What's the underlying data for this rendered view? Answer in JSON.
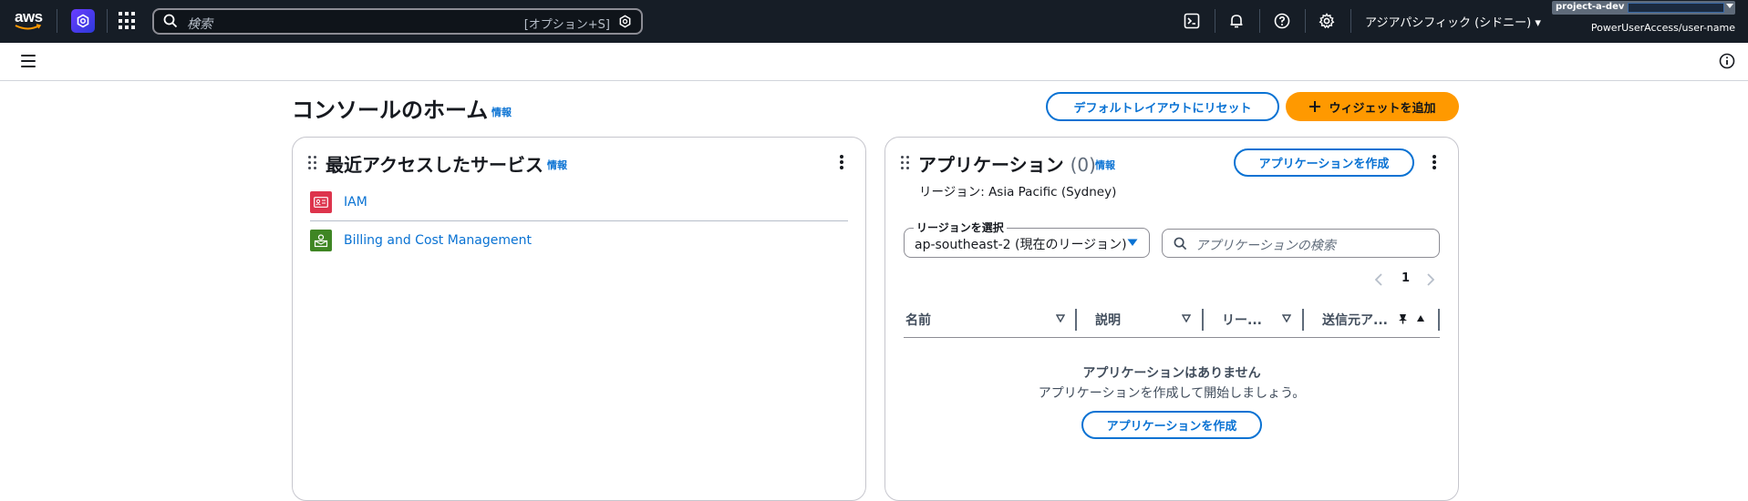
{
  "topnav": {
    "logo_text": "aws",
    "search_placeholder": "検索",
    "search_shortcut": "[オプション+S]",
    "region_label": "アジアパシフィック (シドニー) ▾",
    "account_label": "project-a-dev",
    "role_label": "PowerUserAccess/user-name",
    "icons": [
      "cloudshell-icon",
      "bell-icon",
      "help-icon",
      "gear-icon"
    ]
  },
  "page": {
    "title": "コンソールのホーム",
    "info": "情報",
    "reset_button": "デフォルトレイアウトにリセット",
    "add_widget_button": "ウィジェットを追加"
  },
  "recent_widget": {
    "title": "最近アクセスしたサービス",
    "info": "情報",
    "services": [
      {
        "name": "IAM",
        "color": "#dd344c"
      },
      {
        "name": "Billing and Cost Management",
        "color": "#3f8624"
      }
    ]
  },
  "apps_widget": {
    "title": "アプリケーション",
    "count": "(0)",
    "info": "情報",
    "create_button": "アプリケーションを作成",
    "region_text": "リージョン: Asia Pacific (Sydney)",
    "region_select_label": "リージョンを選択",
    "region_select_value": "ap-southeast-2 (現在のリージョン)",
    "search_placeholder": "アプリケーションの検索",
    "page_number": "1",
    "columns": [
      "名前",
      "説明",
      "リー...",
      "送信元ア..."
    ],
    "empty_title": "アプリケーションはありません",
    "empty_sub": "アプリケーションを作成して開始しましょう。",
    "empty_create_button": "アプリケーションを作成"
  },
  "colors": {
    "nav_bg": "#161d26",
    "link": "#0972d3",
    "primary": "#ff9900"
  }
}
